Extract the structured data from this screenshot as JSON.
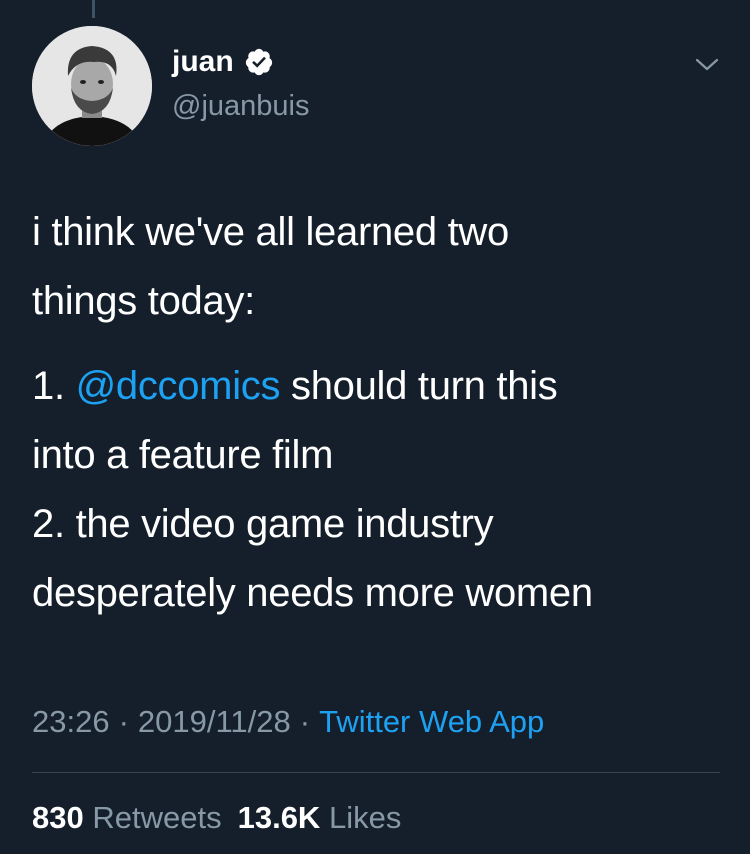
{
  "author": {
    "display_name": "juan",
    "handle": "@juanbuis",
    "verified": true
  },
  "tweet": {
    "line1": "i think we've all learned two",
    "line2": "things today:",
    "item1_prefix": "1. ",
    "item1_mention": "@dccomics",
    "item1_rest": " should turn this",
    "item1_line2": "into a feature film",
    "item2_line1": "2. the video game industry",
    "item2_line2": "desperately needs more women"
  },
  "meta": {
    "time": "23:26",
    "date": "2019/11/28",
    "separator": "·",
    "source": "Twitter Web App"
  },
  "stats": {
    "retweets_count": "830",
    "retweets_label": "Retweets",
    "likes_count": "13.6K",
    "likes_label": "Likes"
  },
  "colors": {
    "background": "#151f2b",
    "accent": "#1da1f2",
    "secondary_text": "#8899a6"
  },
  "icons": {
    "verified": "verified-badge-icon",
    "menu": "chevron-down-icon"
  }
}
